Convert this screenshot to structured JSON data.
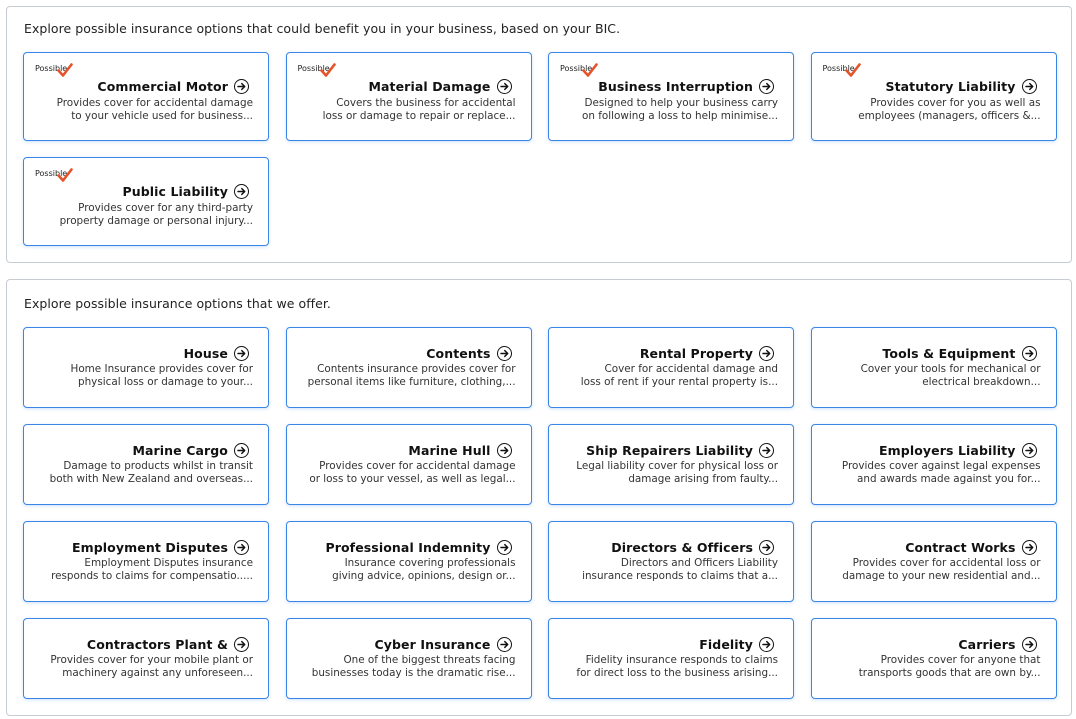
{
  "bic_section": {
    "heading": "Explore possible insurance options that could benefit you in your business, based on your BIC.",
    "possible_label": "Possible",
    "check_color": "#e5532a",
    "cards": [
      {
        "title": "Commercial Motor",
        "desc1": "Provides cover for accidental damage",
        "desc2": "to your vehicle used for business..."
      },
      {
        "title": "Material Damage",
        "desc1": "Covers the business for accidental",
        "desc2": "loss or damage to repair or replace..."
      },
      {
        "title": "Business Interruption",
        "desc1": "Designed to help your business carry",
        "desc2": "on following a loss to help minimise..."
      },
      {
        "title": "Statutory Liability",
        "desc1": "Provides cover for you as well as",
        "desc2": "employees (managers, officers &..."
      },
      {
        "title": "Public Liability",
        "desc1": "Provides cover for any third-party",
        "desc2": "property damage or personal injury..."
      }
    ]
  },
  "offer_section": {
    "heading": "Explore possible insurance options that we offer.",
    "cards": [
      {
        "title": "House",
        "desc1": "Home Insurance provides cover for",
        "desc2": "physical loss or damage to your..."
      },
      {
        "title": "Contents",
        "desc1": "Contents insurance provides cover for",
        "desc2": "personal items like furniture, clothing,..."
      },
      {
        "title": "Rental Property",
        "desc1": "Cover for accidental damage and",
        "desc2": "loss of rent if your rental property is..."
      },
      {
        "title": "Tools & Equipment",
        "desc1": "Cover your tools for mechanical or",
        "desc2": "electrical breakdown..."
      },
      {
        "title": "Marine Cargo",
        "desc1": "Damage to products whilst in transit",
        "desc2": "both with New Zealand and overseas..."
      },
      {
        "title": "Marine Hull",
        "desc1": "Provides cover for accidental damage",
        "desc2": "or loss to your vessel, as well as legal..."
      },
      {
        "title": "Ship Repairers Liability",
        "desc1": "Legal liability cover for physical loss or",
        "desc2": "damage arising from faulty..."
      },
      {
        "title": "Employers Liability",
        "desc1": "Provides cover against legal expenses",
        "desc2": "and awards made against you for..."
      },
      {
        "title": "Employment Disputes",
        "desc1": "Employment Disputes insurance",
        "desc2": "responds to claims for compensatio....."
      },
      {
        "title": "Professional Indemnity",
        "desc1": "Insurance covering professionals",
        "desc2": "giving advice, opinions, design or..."
      },
      {
        "title": "Directors & Officers",
        "desc1": "Directors and Officers Liability",
        "desc2": "insurance responds to claims that a..."
      },
      {
        "title": "Contract Works",
        "desc1": "Provides cover for accidental loss or",
        "desc2": "damage to your new residential and..."
      },
      {
        "title": "Contractors Plant &",
        "desc1": "Provides cover for your mobile plant or",
        "desc2": "machinery against any unforeseen..."
      },
      {
        "title": "Cyber Insurance",
        "desc1": "One of the biggest threats facing",
        "desc2": "businesses today is the dramatic rise..."
      },
      {
        "title": "Fidelity",
        "desc1": "Fidelity insurance responds to claims",
        "desc2": "for direct loss to the business arising..."
      },
      {
        "title": "Carriers",
        "desc1": "Provides cover for anyone that",
        "desc2": "transports goods that are own by..."
      }
    ]
  },
  "icons": {
    "arrow": "arrow-right-circle-icon",
    "check": "checkmark-icon"
  }
}
